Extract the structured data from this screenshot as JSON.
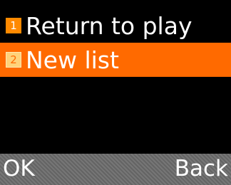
{
  "menu": {
    "items": [
      {
        "number": "1",
        "label": "Return to play",
        "selected": false
      },
      {
        "number": "2",
        "label": "New list",
        "selected": true
      }
    ]
  },
  "softkeys": {
    "left": "OK",
    "right": "Back"
  },
  "colors": {
    "background": "#000000",
    "highlight": "#ff6a00",
    "badge": "#ff8a00",
    "softkey_bar": "#6c6c6c",
    "text": "#ffffff"
  }
}
